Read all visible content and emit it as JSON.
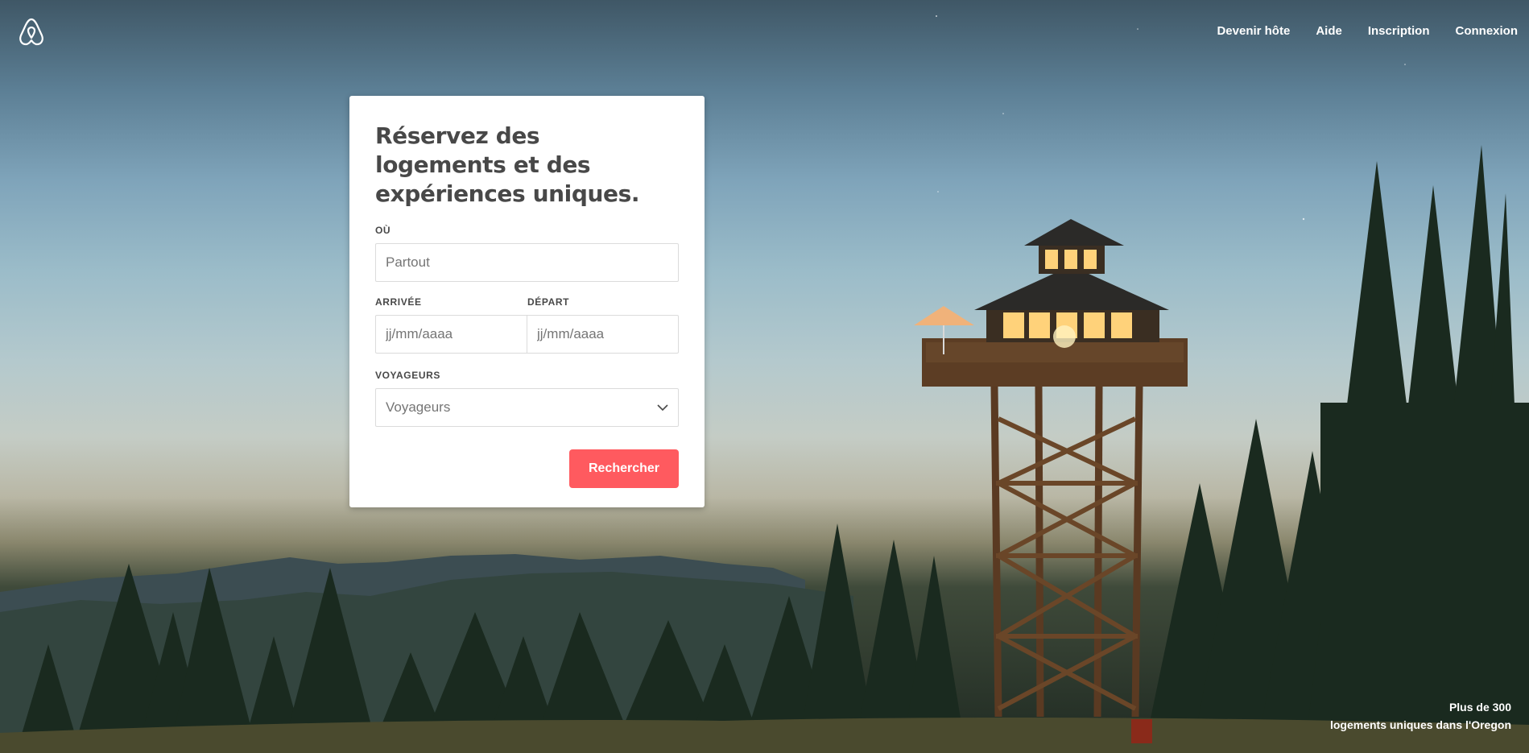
{
  "header": {
    "logo_icon": "airbnb-belo-icon",
    "nav": [
      {
        "label": "Devenir hôte"
      },
      {
        "label": "Aide"
      },
      {
        "label": "Inscription"
      },
      {
        "label": "Connexion"
      }
    ]
  },
  "search_card": {
    "title": "Réservez des logements et des expériences uniques.",
    "where": {
      "label": "OÙ",
      "placeholder": "Partout"
    },
    "checkin": {
      "label": "ARRIVÉE",
      "placeholder": "jj/mm/aaaa"
    },
    "checkout": {
      "label": "DÉPART",
      "placeholder": "jj/mm/aaaa"
    },
    "guests": {
      "label": "VOYAGEURS",
      "value": "Voyageurs",
      "icon": "chevron-down-icon"
    },
    "submit_label": "Rechercher"
  },
  "caption": {
    "line1": "Plus de 300",
    "line2": "logements uniques dans l'Oregon"
  },
  "colors": {
    "accent": "#ff5a5f",
    "text": "#484848"
  }
}
